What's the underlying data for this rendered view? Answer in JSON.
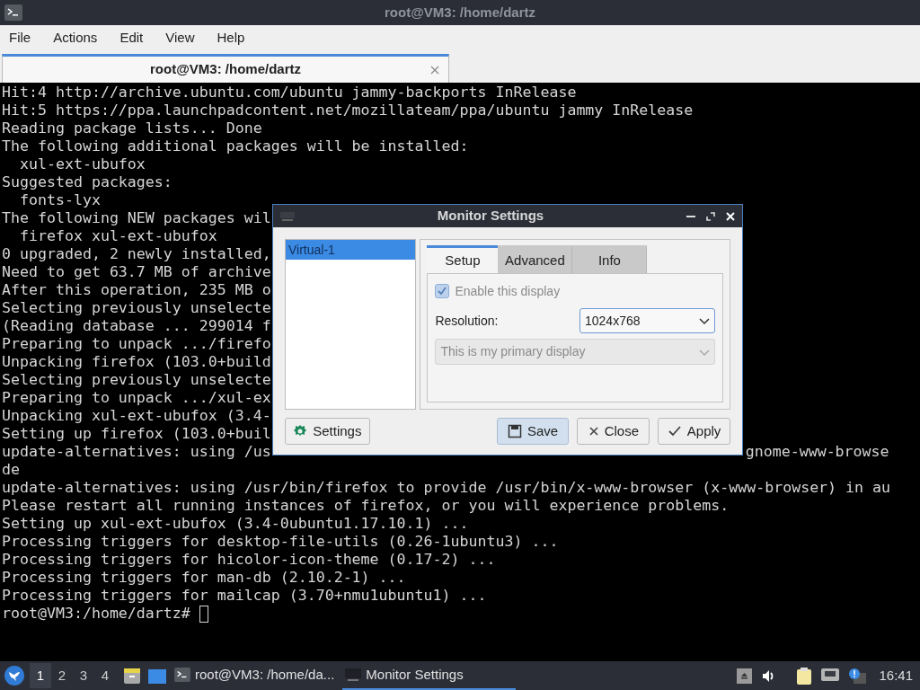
{
  "window": {
    "title": "root@VM3: /home/dartz"
  },
  "menu": [
    "File",
    "Actions",
    "Edit",
    "View",
    "Help"
  ],
  "tabs": [
    {
      "label": "root@VM3: /home/dartz",
      "selected": true
    }
  ],
  "terminal": {
    "lines": [
      {
        "text": "Hit:4 http://archive.ubuntu.com/ubuntu jammy-backports InRelease"
      },
      {
        "text": "Hit:5 https://ppa.launchpadcontent.net/mozillateam/ppa/ubuntu jammy InRelease"
      },
      {
        "text": "Reading package lists... Done"
      },
      {
        "text": "The following additional packages will be installed:"
      },
      {
        "text": "  xul-ext-ubufox"
      },
      {
        "text": "Suggested packages:"
      },
      {
        "text": "  fonts-lyx"
      },
      {
        "text": "The following NEW packages wil"
      },
      {
        "text": "  firefox xul-ext-ubufox"
      },
      {
        "text": "0 upgraded, 2 newly installed,"
      },
      {
        "text": "Need to get 63.7 MB of archive"
      },
      {
        "text": "After this operation, 235 MB o"
      },
      {
        "text": "Selecting previously unselecte"
      },
      {
        "text": "(Reading database ... 299014 f"
      },
      {
        "text": "Preparing to unpack .../firefo"
      },
      {
        "text": "Unpacking firefox (103.0+build"
      },
      {
        "text": "Selecting previously unselecte"
      },
      {
        "text": "Preparing to unpack .../xul-ex"
      },
      {
        "text": "Unpacking xul-ext-ubufox (3.4-"
      },
      {
        "text": "Setting up firefox (103.0+buil"
      },
      {
        "text": "update-alternatives: using /us",
        "tail": "gnome-www-browse"
      },
      {
        "text": "de"
      },
      {
        "text": "update-alternatives: using /usr/bin/firefox to provide /usr/bin/x-www-browser (x-www-browser) in au"
      },
      {
        "text": "Please restart all running instances of firefox, or you will experience problems."
      },
      {
        "text": "Setting up xul-ext-ubufox (3.4-0ubuntu1.17.10.1) ..."
      },
      {
        "text": "Processing triggers for desktop-file-utils (0.26-1ubuntu3) ..."
      },
      {
        "text": "Processing triggers for hicolor-icon-theme (0.17-2) ..."
      },
      {
        "text": "Processing triggers for man-db (2.10.2-1) ..."
      },
      {
        "text": "Processing triggers for mailcap (3.70+nmu1ubuntu1) ..."
      }
    ],
    "prompt": "root@VM3:/home/dartz# "
  },
  "dialog": {
    "title": "Monitor Settings",
    "monitors": [
      {
        "name": "Virtual-1",
        "selected": true
      }
    ],
    "tabs": [
      {
        "label": "Setup",
        "selected": true
      },
      {
        "label": "Advanced",
        "selected": false
      },
      {
        "label": "Info",
        "selected": false
      }
    ],
    "enable": {
      "label": "Enable this display",
      "checked": true,
      "disabled": true
    },
    "resolution": {
      "label": "Resolution:",
      "value": "1024x768"
    },
    "primary": {
      "value": "This is my primary display",
      "disabled": true
    },
    "buttons": [
      {
        "label": "Settings",
        "kind": "settings",
        "default": false
      },
      {
        "label": "Save",
        "kind": "save",
        "default": true
      },
      {
        "label": "Close",
        "kind": "close",
        "default": false
      },
      {
        "label": "Apply",
        "kind": "apply",
        "default": false
      }
    ]
  },
  "taskbar": {
    "workspaces": [
      {
        "label": "1",
        "selected": true
      },
      {
        "label": "2",
        "selected": false
      },
      {
        "label": "3",
        "selected": false
      },
      {
        "label": "4",
        "selected": false
      }
    ],
    "tasks": [
      {
        "label": "root@VM3: /home/da...",
        "kind": "terminal",
        "selected": false
      },
      {
        "label": "Monitor Settings",
        "kind": "monitor",
        "selected": true
      }
    ],
    "clock": "16:41"
  }
}
